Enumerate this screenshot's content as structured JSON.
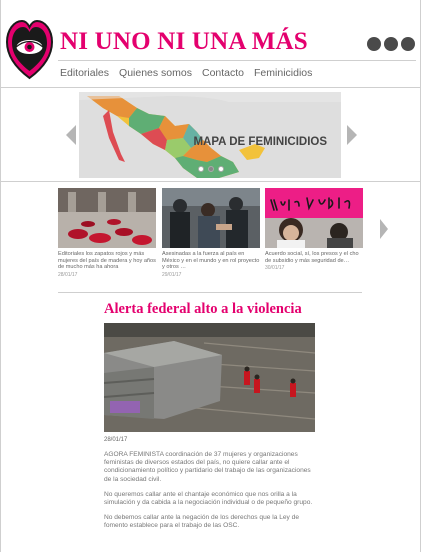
{
  "header": {
    "site_title": "NI UNO NI UNA MÁS",
    "logo_icon": "heart-eye-logo-icon",
    "menu_icon": "three-dots-menu-icon"
  },
  "nav": {
    "items": [
      "Editoriales",
      "Quienes somos",
      "Contacto",
      "Feminicidios"
    ]
  },
  "slider": {
    "caption": "MAPA DE FEMINICIDIOS",
    "prev_icon": "chevron-left-icon",
    "next_icon": "chevron-right-icon",
    "dots": 3,
    "active_dot": 2
  },
  "carousel": {
    "items": [
      {
        "text": "Editoriales los zapatos rojos y más mujeres del país de madera y hoy años de mucho más ha ahora",
        "date": "28/01/17"
      },
      {
        "text": "Asesinadas a la fuerza al país en México y en el mundo y en rol proyecto y otros …",
        "date": "29/01/17"
      },
      {
        "text": "Acuerdo social, sí, los presos y el cho de subsidio y más seguridad de…",
        "date": "30/01/17"
      }
    ],
    "next_icon": "chevron-right-icon"
  },
  "article": {
    "title": "Alerta federal alto a la violencia",
    "date": "28/01/17",
    "paragraphs": [
      "AGORA FEMINISTA coordinación de 37 mujeres y organizaciones feministas de diversos estados del país, no quiere callar ante el condicionamiento político y partidario del trabajo de las organizaciones de la sociedad civil.",
      "No queremos callar ante el chantaje económico que nos orilla a la simulación y da cabida a la negociación individual o de pequeño grupo.",
      "No debemos callar ante la negación de los derechos que la Ley de fomento establece para el trabajo de las OSC."
    ]
  },
  "colors": {
    "brand_pink": "#e4006e",
    "text_gray": "#444444"
  }
}
